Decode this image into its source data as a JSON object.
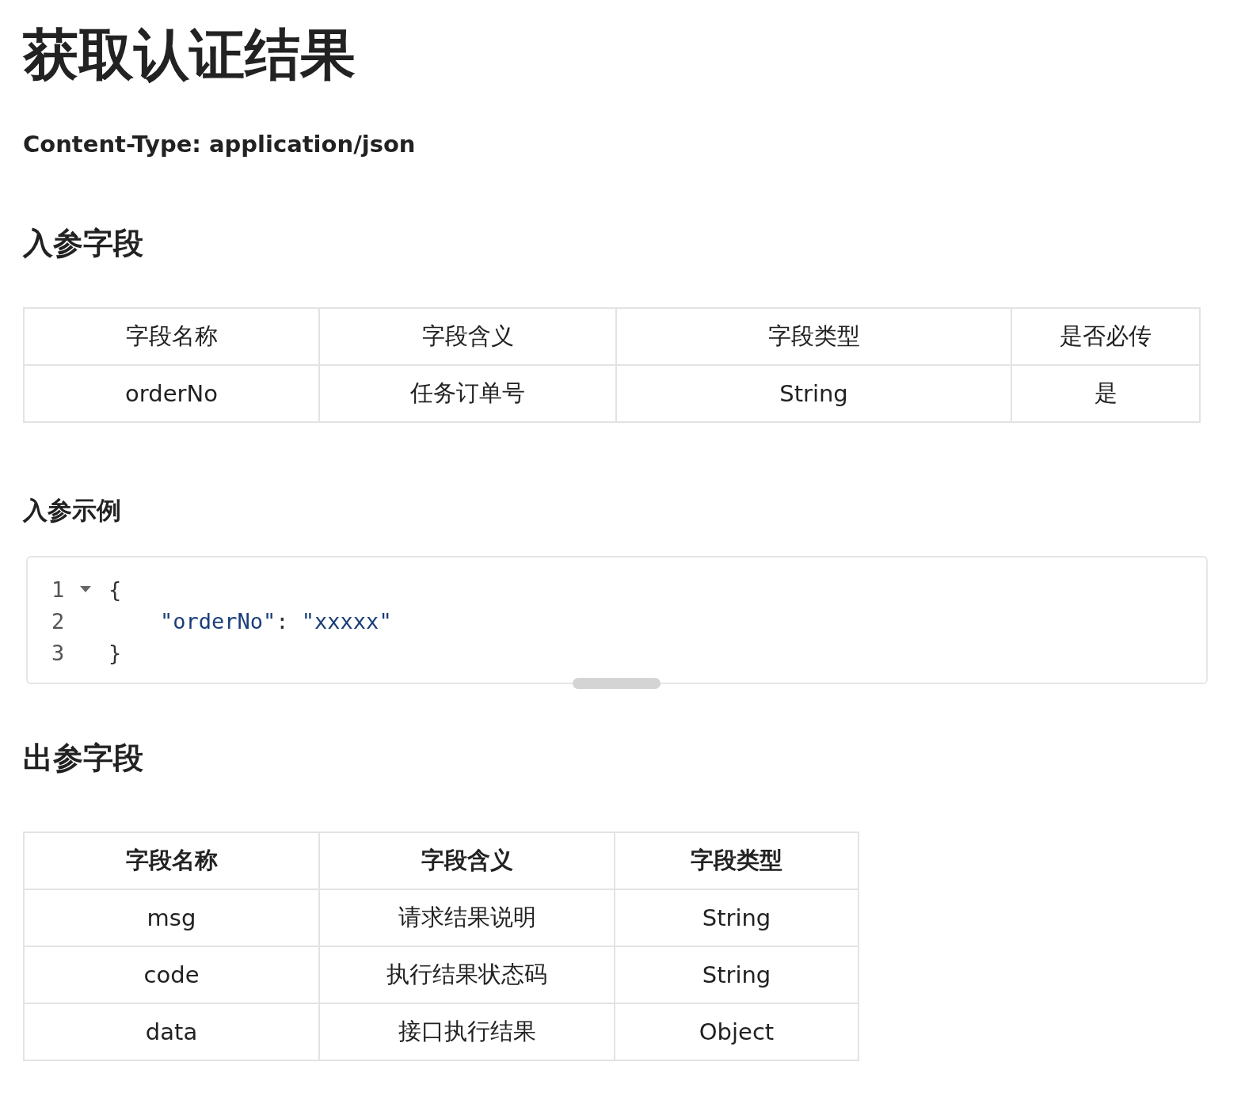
{
  "title": "获取认证结果",
  "content_type": "Content-Type: application/json",
  "input_section": {
    "heading": "入参字段",
    "table": {
      "header_bold": false,
      "columns": [
        "字段名称",
        "字段含义",
        "字段类型",
        "是否必传"
      ],
      "rows": [
        [
          "orderNo",
          "任务订单号",
          "String",
          "是"
        ]
      ]
    }
  },
  "example_section": {
    "heading": "入参示例",
    "code": [
      {
        "number": "1",
        "foldable": true,
        "tokens": [
          {
            "kind": "punct",
            "text": "{"
          }
        ]
      },
      {
        "number": "2",
        "foldable": false,
        "tokens": [
          {
            "kind": "string",
            "text": "    \"orderNo\""
          },
          {
            "kind": "punct",
            "text": ": "
          },
          {
            "kind": "string",
            "text": "\"xxxxx\""
          }
        ]
      },
      {
        "number": "3",
        "foldable": false,
        "tokens": [
          {
            "kind": "punct",
            "text": "}"
          }
        ]
      }
    ]
  },
  "output_section": {
    "heading": "出参字段",
    "table": {
      "header_bold": true,
      "columns": [
        "字段名称",
        "字段含义",
        "字段类型"
      ],
      "rows": [
        [
          "msg",
          "请求结果说明",
          "String"
        ],
        [
          "code",
          "执行结果状态码",
          "String"
        ],
        [
          "data",
          "接口执行结果",
          "Object"
        ]
      ]
    }
  }
}
